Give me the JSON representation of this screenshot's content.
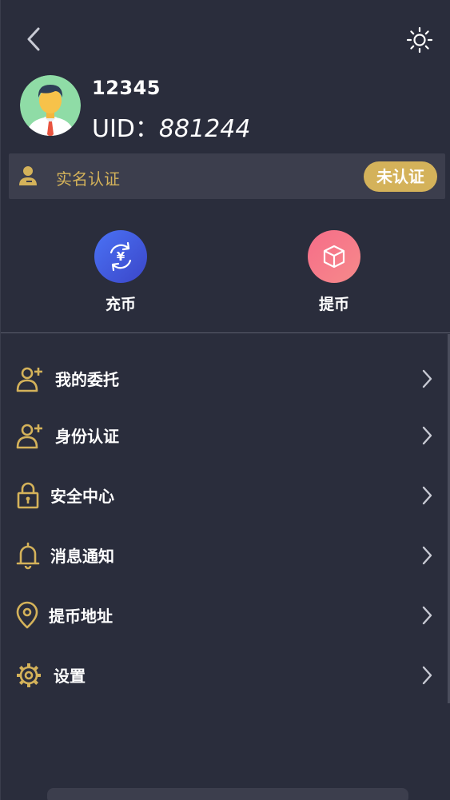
{
  "header": {
    "back_icon": "chevron-left-icon",
    "theme_icon": "sun-icon"
  },
  "profile": {
    "username": "12345",
    "uid_label": "UID：",
    "uid_value": "881244",
    "avatar": "avatar-man-icon"
  },
  "verification": {
    "label": "实名认证",
    "status": "未认证",
    "icon": "person-icon",
    "accent_color": "#d4b25a"
  },
  "actions": [
    {
      "label": "充币",
      "icon": "yuan-refresh-icon",
      "color": "#4a5ae8"
    },
    {
      "label": "提币",
      "icon": "box-icon",
      "color": "#f6768a"
    }
  ],
  "menu": [
    {
      "label": "我的委托",
      "icon": "add-user-icon"
    },
    {
      "label": "身份认证",
      "icon": "add-user-icon"
    },
    {
      "label": "安全中心",
      "icon": "lock-icon"
    },
    {
      "label": "消息通知",
      "icon": "bell-icon"
    },
    {
      "label": "提币地址",
      "icon": "location-pin-icon"
    },
    {
      "label": "设置",
      "icon": "gear-icon"
    }
  ],
  "colors": {
    "background": "#2a2d3c",
    "panel": "#3c3e4d",
    "gold": "#d4b25a"
  }
}
